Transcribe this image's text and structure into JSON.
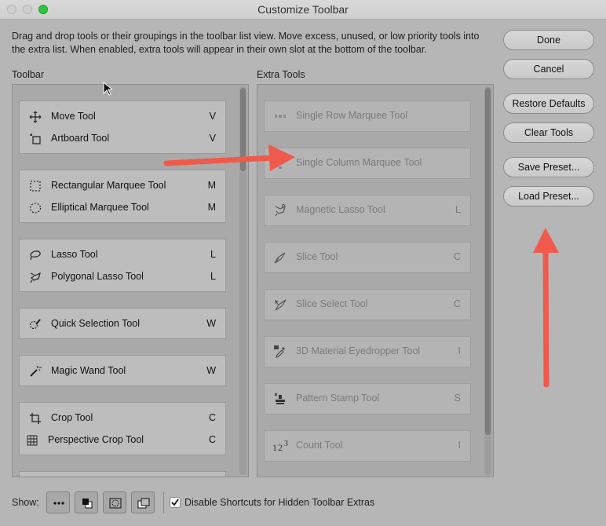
{
  "window": {
    "title": "Customize Toolbar"
  },
  "description": "Drag and drop tools or their groupings in the toolbar list view. Move excess, unused, or low priority tools into the extra list. When enabled, extra tools will appear in their own slot at the bottom of the toolbar.",
  "toolbar": {
    "label": "Toolbar",
    "groups": [
      {
        "tools": [
          {
            "name": "Move Tool",
            "shortcut": "V",
            "icon": "move-icon"
          },
          {
            "name": "Artboard Tool",
            "shortcut": "V",
            "icon": "artboard-icon"
          }
        ]
      },
      {
        "tools": [
          {
            "name": "Rectangular Marquee Tool",
            "shortcut": "M",
            "icon": "rect-marquee-icon"
          },
          {
            "name": "Elliptical Marquee Tool",
            "shortcut": "M",
            "icon": "ellip-marquee-icon"
          }
        ]
      },
      {
        "tools": [
          {
            "name": "Lasso Tool",
            "shortcut": "L",
            "icon": "lasso-icon"
          },
          {
            "name": "Polygonal Lasso Tool",
            "shortcut": "L",
            "icon": "poly-lasso-icon"
          }
        ]
      },
      {
        "tools": [
          {
            "name": "Quick Selection Tool",
            "shortcut": "W",
            "icon": "quick-selection-icon"
          }
        ]
      },
      {
        "tools": [
          {
            "name": "Magic Wand Tool",
            "shortcut": "W",
            "icon": "magic-wand-icon"
          }
        ]
      },
      {
        "tools": [
          {
            "name": "Crop Tool",
            "shortcut": "C",
            "icon": "crop-icon"
          },
          {
            "name": "Perspective Crop Tool",
            "shortcut": "C",
            "icon": "persp-crop-icon"
          }
        ]
      }
    ]
  },
  "extra": {
    "label": "Extra Tools",
    "tools": [
      {
        "name": "Single Row Marquee Tool",
        "shortcut": "",
        "icon": "single-row-icon"
      },
      {
        "name": "Single Column Marquee Tool",
        "shortcut": "",
        "icon": "single-column-icon"
      },
      {
        "name": "Magnetic Lasso Tool",
        "shortcut": "L",
        "icon": "magnetic-lasso-icon"
      },
      {
        "name": "Slice Tool",
        "shortcut": "C",
        "icon": "slice-icon"
      },
      {
        "name": "Slice Select Tool",
        "shortcut": "C",
        "icon": "slice-select-icon"
      },
      {
        "name": "3D Material Eyedropper Tool",
        "shortcut": "I",
        "icon": "eyedropper-3d-icon"
      },
      {
        "name": "Pattern Stamp Tool",
        "shortcut": "S",
        "icon": "pattern-stamp-icon"
      },
      {
        "name": "Count Tool",
        "shortcut": "I",
        "icon": "count-icon"
      }
    ]
  },
  "buttons": {
    "done": "Done",
    "cancel": "Cancel",
    "restore": "Restore Defaults",
    "clear": "Clear Tools",
    "save_preset": "Save Preset...",
    "load_preset": "Load Preset..."
  },
  "footer": {
    "show_label": "Show:",
    "view_icons": [
      "more-icon",
      "color-swatch-icon",
      "quick-mask-icon",
      "screen-mode-icon"
    ],
    "checkbox_label": "Disable Shortcuts for Hidden Toolbar Extras",
    "checkbox_checked": true
  },
  "colors": {
    "annotation_arrow": "#ef5a4c",
    "window_bg": "#b6b6b6"
  }
}
